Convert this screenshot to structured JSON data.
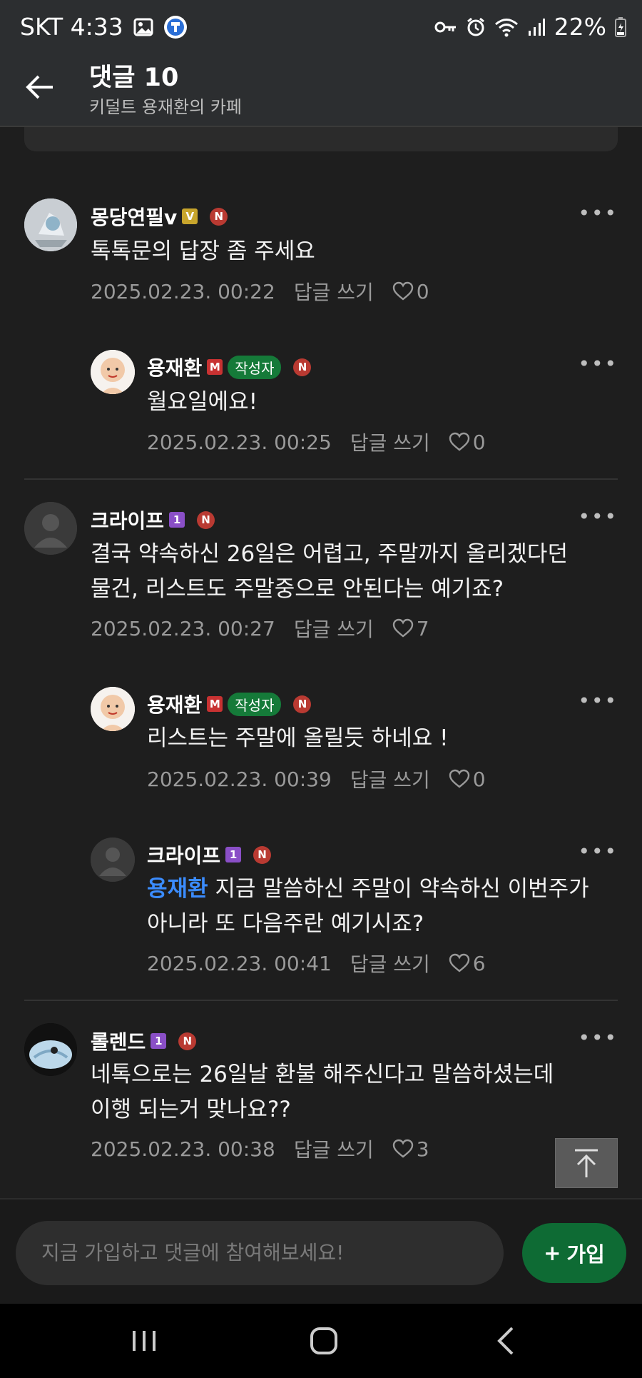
{
  "status_bar": {
    "carrier_time": "SKT 4:33",
    "battery": "22%"
  },
  "header": {
    "title": "댓글 10",
    "subtitle": "키덜트 용재환의 카페"
  },
  "comments": [
    {
      "nickname": "몽당연필v",
      "level_badge": "V",
      "text_lines": [
        "톡톡문의 답장 좀 주세요"
      ],
      "date": "2025.02.23. 00:22",
      "reply": "답글 쓰기",
      "likes": "0"
    },
    {
      "nickname": "용재환",
      "level_badge": "M",
      "author_tag": "작성자",
      "text_lines": [
        "월요일에요!"
      ],
      "date": "2025.02.23. 00:25",
      "reply": "답글 쓰기",
      "likes": "0"
    },
    {
      "nickname": "크라이프",
      "level_badge": "1",
      "text_lines": [
        "결국 약속하신 26일은 어렵고, 주말까지 올리겠다던",
        "물건, 리스트도 주말중으로 안된다는 예기죠?"
      ],
      "date": "2025.02.23. 00:27",
      "reply": "답글 쓰기",
      "likes": "7"
    },
    {
      "nickname": "용재환",
      "level_badge": "M",
      "author_tag": "작성자",
      "text_lines": [
        "리스트는 주말에 올릴듯 하네요 !"
      ],
      "date": "2025.02.23. 00:39",
      "reply": "답글 쓰기",
      "likes": "0"
    },
    {
      "nickname": "크라이프",
      "level_badge": "1",
      "mention": "용재환",
      "text_lines": [
        " 지금 말씀하신 주말이 약속하신 이번주가",
        "아니라 또 다음주란 예기시죠?"
      ],
      "date": "2025.02.23. 00:41",
      "reply": "답글 쓰기",
      "likes": "6"
    },
    {
      "nickname": "롤렌드",
      "level_badge": "1",
      "text_lines": [
        "네톡으로는 26일날 환불 해주신다고 말씀하셨는데",
        "이행 되는거 맞나요??"
      ],
      "date": "2025.02.23. 00:38",
      "reply": "답글 쓰기",
      "likes": "3"
    }
  ],
  "new_badge": "N",
  "more_glyph": "•••",
  "input": {
    "placeholder": "지금 가입하고 댓글에 참여해보세요!"
  },
  "join_button": {
    "plus": "+",
    "label": "가입"
  },
  "colors": {
    "background": "#1e1e1e",
    "bar": "#2c2e30",
    "join": "#0e6b34",
    "mention": "#3b8cff",
    "new_badge": "#b93a32",
    "author_tag": "#157a39"
  }
}
